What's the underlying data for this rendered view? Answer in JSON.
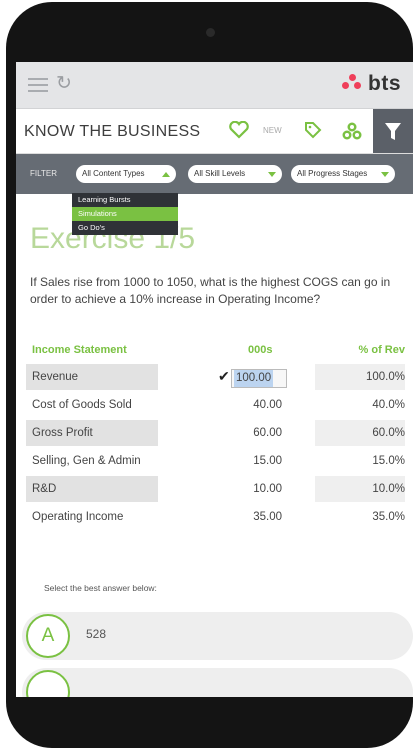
{
  "header": {
    "brand": "bts"
  },
  "titlebar": {
    "title": "KNOW THE BUSINESS",
    "new_label": "NEW"
  },
  "filter": {
    "label": "FILTER",
    "content_types": "All Content Types",
    "skill_levels": "All Skill Levels",
    "progress_stages": "All Progress Stages",
    "dropdown_items": [
      "Learning Bursts",
      "Simulations",
      "Go Do's"
    ]
  },
  "exercise": {
    "title": "Exercise 1/5",
    "question": "If Sales rise from 1000 to 1050, what is the highest COGS can go in order to achieve a 10% increase in Operating Income?"
  },
  "table": {
    "headers": [
      "Income Statement",
      "000s",
      "% of Rev"
    ],
    "rows": [
      {
        "label": "Revenue",
        "value": "100.00",
        "pct": "100.0%"
      },
      {
        "label": "Cost of Goods Sold",
        "value": "40.00",
        "pct": "40.0%"
      },
      {
        "label": "Gross Profit",
        "value": "60.00",
        "pct": "60.0%"
      },
      {
        "label": "Selling, Gen & Admin",
        "value": "15.00",
        "pct": "15.0%"
      },
      {
        "label": "R&D",
        "value": "10.00",
        "pct": "10.0%"
      },
      {
        "label": "Operating Income",
        "value": "35.00",
        "pct": "35.0%"
      }
    ]
  },
  "answers": {
    "prompt": "Select the best answer below:",
    "items": [
      {
        "letter": "A",
        "text": "528"
      }
    ]
  },
  "colors": {
    "accent": "#7ac142",
    "brand_dots": "#ef3f5a",
    "filterbar": "#666c74"
  }
}
